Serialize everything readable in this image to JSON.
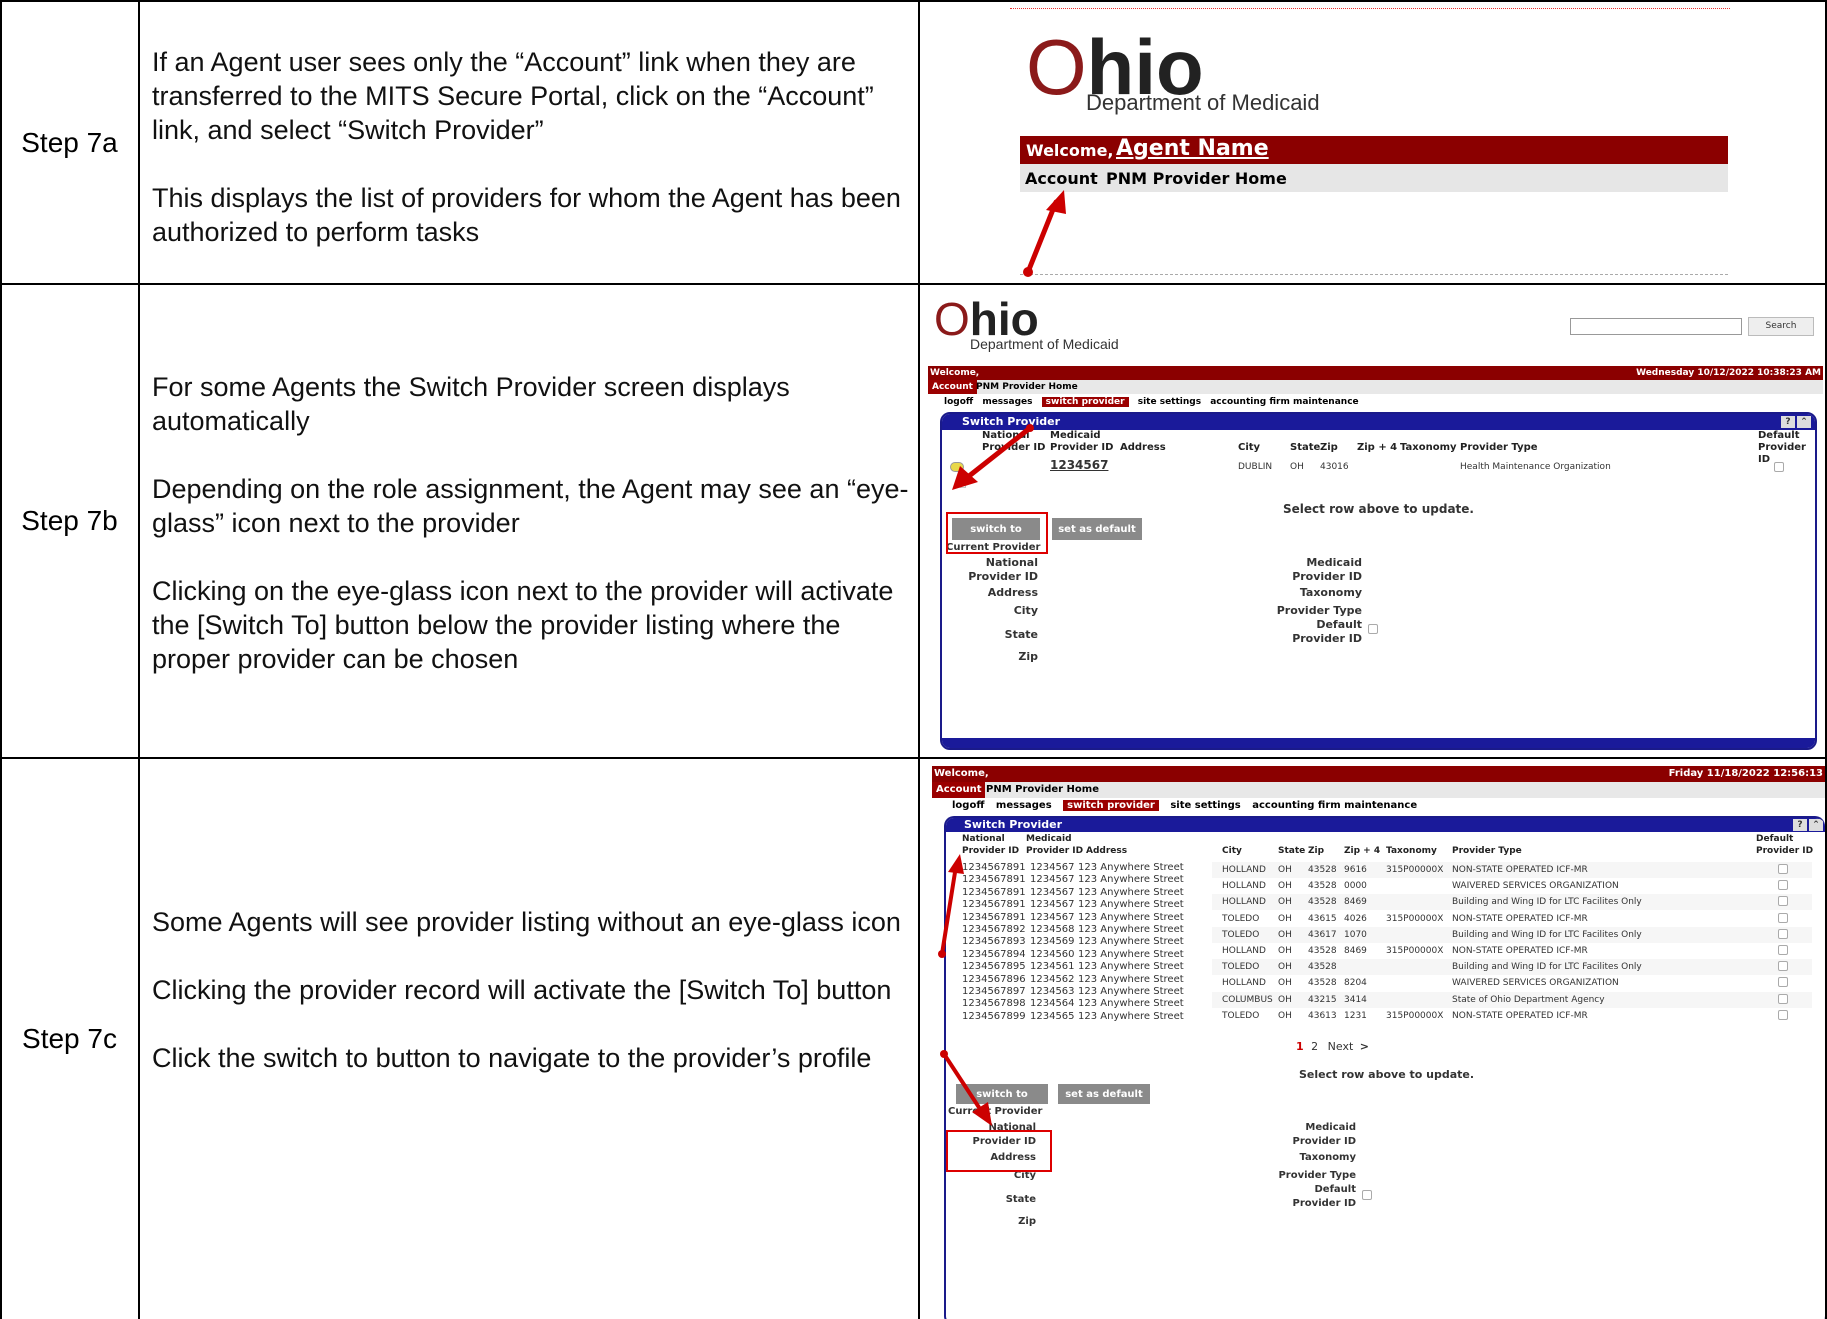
{
  "rows": [
    {
      "step": "Step 7a",
      "paras": [
        "If an Agent user sees only the “Account” link when they are transferred to the MITS Secure Portal, click on the “Account” link, and select “Switch Provider”",
        "This displays the list of providers for whom the Agent has been authorized to perform tasks"
      ]
    },
    {
      "step": "Step 7b",
      "paras": [
        "For some Agents the Switch Provider screen displays automatically",
        "Depending on the role assignment, the Agent may see an “eye-glass” icon next to the provider",
        "Clicking on the eye-glass icon next to the provider will activate the [Switch To] button below the provider listing where the proper provider can be chosen"
      ]
    },
    {
      "step": "Step 7c",
      "paras": [
        "Some Agents will see provider listing without an eye-glass icon",
        "Clicking the provider record will activate the [Switch To] button",
        "Click the switch to button to navigate to the provider’s profile"
      ]
    }
  ],
  "shotA": {
    "logo_o": "O",
    "logo_rest": "hio",
    "dept": "Department of Medicaid",
    "welcome": "Welcome,",
    "agent": "Agent Name",
    "account": "Account",
    "pnm": "PNM Provider Home"
  },
  "shotB": {
    "logo_o": "O",
    "logo_rest": "hio",
    "dept": "Department of Medicaid",
    "search": "Search",
    "welcome": "Welcome,",
    "date": "Wednesday 10/12/2022 10:38:23 AM",
    "account": "Account",
    "pnm": "PNM Provider Home",
    "menu": [
      "logoff",
      "messages",
      "switch provider",
      "site settings",
      "accounting firm maintenance"
    ],
    "panel_title": "Switch Provider",
    "h_national": "National",
    "h_provid": "Provider ID",
    "h_medicaid": "Medicaid",
    "h_provid2": "Provider ID",
    "h_address": "Address",
    "h_city": "City",
    "h_state": "State",
    "h_zip": "Zip",
    "h_zip4": "Zip + 4",
    "h_tax": "Taxonomy",
    "h_type": "Provider Type",
    "h_default": "Default",
    "h_default2": "Provider ID",
    "row": {
      "medicaid": "1234567",
      "city": "DUBLIN",
      "state": "OH",
      "zip": "43016",
      "type": "Health Maintenance Organization"
    },
    "select_msg": "Select row above to update.",
    "switch_to": "switch to",
    "set_default": "set as default",
    "current": "Current Provider",
    "l_national": "National",
    "l_provid": "Provider ID",
    "l_address": "Address",
    "l_city": "City",
    "l_state": "State",
    "l_zip": "Zip",
    "r_medicaid": "Medicaid",
    "r_provid": "Provider ID",
    "r_tax": "Taxonomy",
    "r_type": "Provider Type",
    "r_default": "Default",
    "r_defprov": "Provider ID"
  },
  "shotC": {
    "welcome": "Welcome,",
    "date": "Friday 11/18/2022 12:56:13",
    "account": "Account",
    "pnm": "PNM Provider Home",
    "menu": [
      "logoff",
      "messages",
      "switch provider",
      "site settings",
      "accounting firm maintenance"
    ],
    "panel_title": "Switch Provider",
    "h_national": "National",
    "h_provid": "Provider ID",
    "h_medicaid": "Medicaid",
    "h_provid2": "Provider ID",
    "h_address": "Address",
    "h_city": "City",
    "h_state": "State",
    "h_zip": "Zip",
    "h_zip4": "Zip + 4",
    "h_tax": "Taxonomy",
    "h_type": "Provider Type",
    "h_default": "Default",
    "h_default2": "Provider ID",
    "left_rows": [
      [
        "1234567891",
        "1234567",
        "123 Anywhere Street"
      ],
      [
        "1234567891",
        "1234567",
        "123 Anywhere Street"
      ],
      [
        "1234567891",
        "1234567",
        "123 Anywhere Street"
      ],
      [
        "1234567891",
        "1234567",
        "123 Anywhere Street"
      ],
      [
        "1234567891",
        "1234567",
        "123 Anywhere Street"
      ],
      [
        "1234567892",
        "1234568",
        "123 Anywhere Street"
      ],
      [
        "1234567893",
        "1234569",
        "123 Anywhere Street"
      ],
      [
        "1234567894",
        "1234560",
        "123 Anywhere Street"
      ],
      [
        "1234567895",
        "1234561",
        "123 Anywhere Street"
      ],
      [
        "1234567896",
        "1234562",
        "123 Anywhere Street"
      ],
      [
        "1234567897",
        "1234563",
        "123 Anywhere Street"
      ],
      [
        "1234567898",
        "1234564",
        "123 Anywhere Street"
      ],
      [
        "1234567899",
        "1234565",
        "123 Anywhere Street"
      ]
    ],
    "right_rows": [
      [
        "HOLLAND",
        "OH",
        "43528",
        "9616",
        "315P00000X",
        "NON-STATE OPERATED ICF-MR"
      ],
      [
        "HOLLAND",
        "OH",
        "43528",
        "0000",
        "",
        "WAIVERED SERVICES ORGANIZATION"
      ],
      [
        "HOLLAND",
        "OH",
        "43528",
        "8469",
        "",
        "Building and Wing ID for LTC Facilites Only"
      ],
      [
        "TOLEDO",
        "OH",
        "43615",
        "4026",
        "315P00000X",
        "NON-STATE OPERATED ICF-MR"
      ],
      [
        "TOLEDO",
        "OH",
        "43617",
        "1070",
        "",
        "Building and Wing ID for LTC Facilites Only"
      ],
      [
        "HOLLAND",
        "OH",
        "43528",
        "8469",
        "315P00000X",
        "NON-STATE OPERATED ICF-MR"
      ],
      [
        "TOLEDO",
        "OH",
        "43528",
        "",
        "",
        "Building and Wing ID for LTC Facilites Only"
      ],
      [
        "HOLLAND",
        "OH",
        "43528",
        "8204",
        "",
        "WAIVERED SERVICES ORGANIZATION"
      ],
      [
        "COLUMBUS",
        "OH",
        "43215",
        "3414",
        "",
        "State of Ohio Department Agency"
      ],
      [
        "TOLEDO",
        "OH",
        "43613",
        "1231",
        "315P00000X",
        "NON-STATE OPERATED ICF-MR"
      ]
    ],
    "page1": "1",
    "page2": "2",
    "next": "Next",
    "next_arrow": ">",
    "select_msg": "Select row above to update.",
    "switch_to": "switch to",
    "set_default": "set as default",
    "current": "Current Provider",
    "l_national": "National",
    "l_provid": "Provider ID",
    "l_address": "Address",
    "l_city": "City",
    "l_state": "State",
    "l_zip": "Zip",
    "r_medicaid": "Medicaid",
    "r_provid": "Provider ID",
    "r_tax": "Taxonomy",
    "r_type": "Provider Type",
    "r_default": "Default",
    "r_defprov": "Provider ID"
  }
}
